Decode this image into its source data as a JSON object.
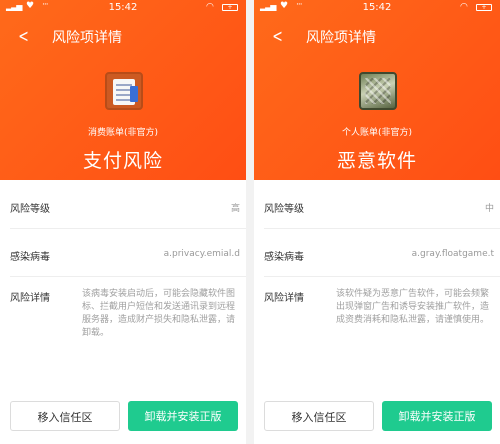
{
  "screens": [
    {
      "status": {
        "time": "15:42",
        "battery": "+"
      },
      "nav_title": "风险项详情",
      "app_icon": "bill-document-icon",
      "app_name": "消费账单(非官方)",
      "risk_type": "支付风险",
      "rows": {
        "level_label": "风险等级",
        "level_value": "高",
        "virus_label": "感染病毒",
        "virus_value": "a.privacy.emial.d",
        "detail_label": "风险详情",
        "detail_value": "该病毒安装启动后，可能会隐藏软件图标、拦截用户短信和发送通讯录到远程服务器，造成财产损失和隐私泄露，请卸载。"
      },
      "buttons": {
        "trust": "移入信任区",
        "uninstall": "卸载并安装正版"
      }
    },
    {
      "status": {
        "time": "15:42",
        "battery": "+"
      },
      "nav_title": "风险项详情",
      "app_icon": "personal-ledger-icon",
      "app_name": "个人账单(非官方)",
      "risk_type": "恶意软件",
      "rows": {
        "level_label": "风险等级",
        "level_value": "中",
        "virus_label": "感染病毒",
        "virus_value": "a.gray.floatgame.t",
        "detail_label": "风险详情",
        "detail_value": "该软件疑为恶意广告软件，可能会频繁出现弹窗广告和诱导安装推广软件，造成资费消耗和隐私泄露，请谨慎使用。"
      },
      "buttons": {
        "trust": "移入信任区",
        "uninstall": "卸载并安装正版"
      }
    }
  ],
  "colors": {
    "header": "#ff5a16",
    "primary_button": "#1fcb8f"
  }
}
